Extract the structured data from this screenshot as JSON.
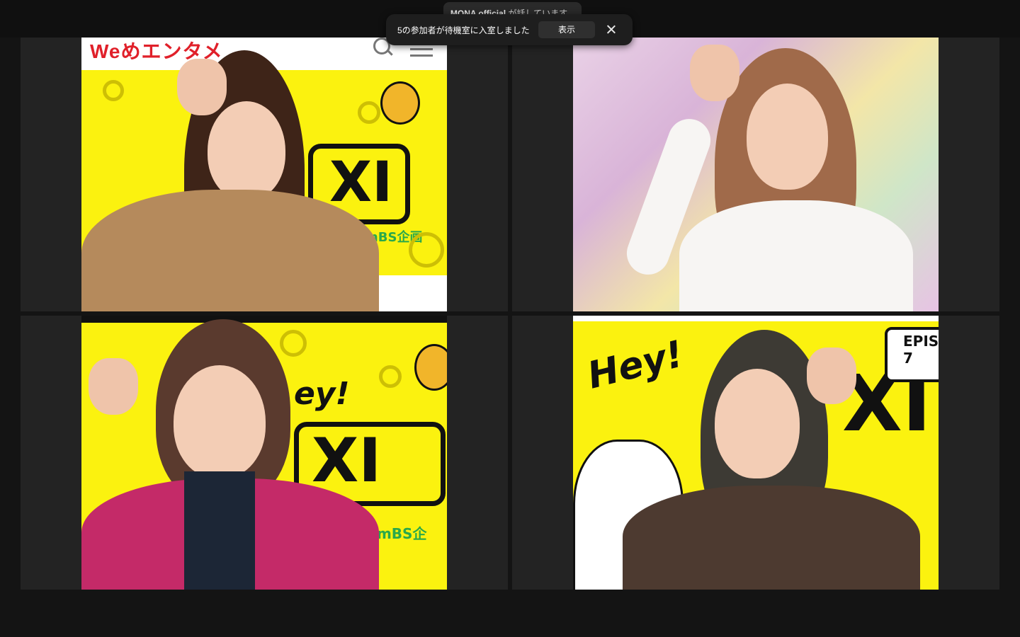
{
  "speaking_indicator": {
    "name": "MONA official",
    "text": "が話しています..."
  },
  "notification": {
    "message": "5の参加者が待機室に入室しました",
    "show_label": "表示"
  },
  "tiles": [
    {
      "sign_text": "XI",
      "brand": "mBS企画",
      "logo": "Weめエンタメ"
    },
    {
      "sign_text": ""
    },
    {
      "sign_text": "XI",
      "hey": "ey!",
      "brand": "社 mBS企"
    },
    {
      "sign_text": "XI",
      "hey": "Hey!",
      "episode": "EPIS 7"
    }
  ]
}
